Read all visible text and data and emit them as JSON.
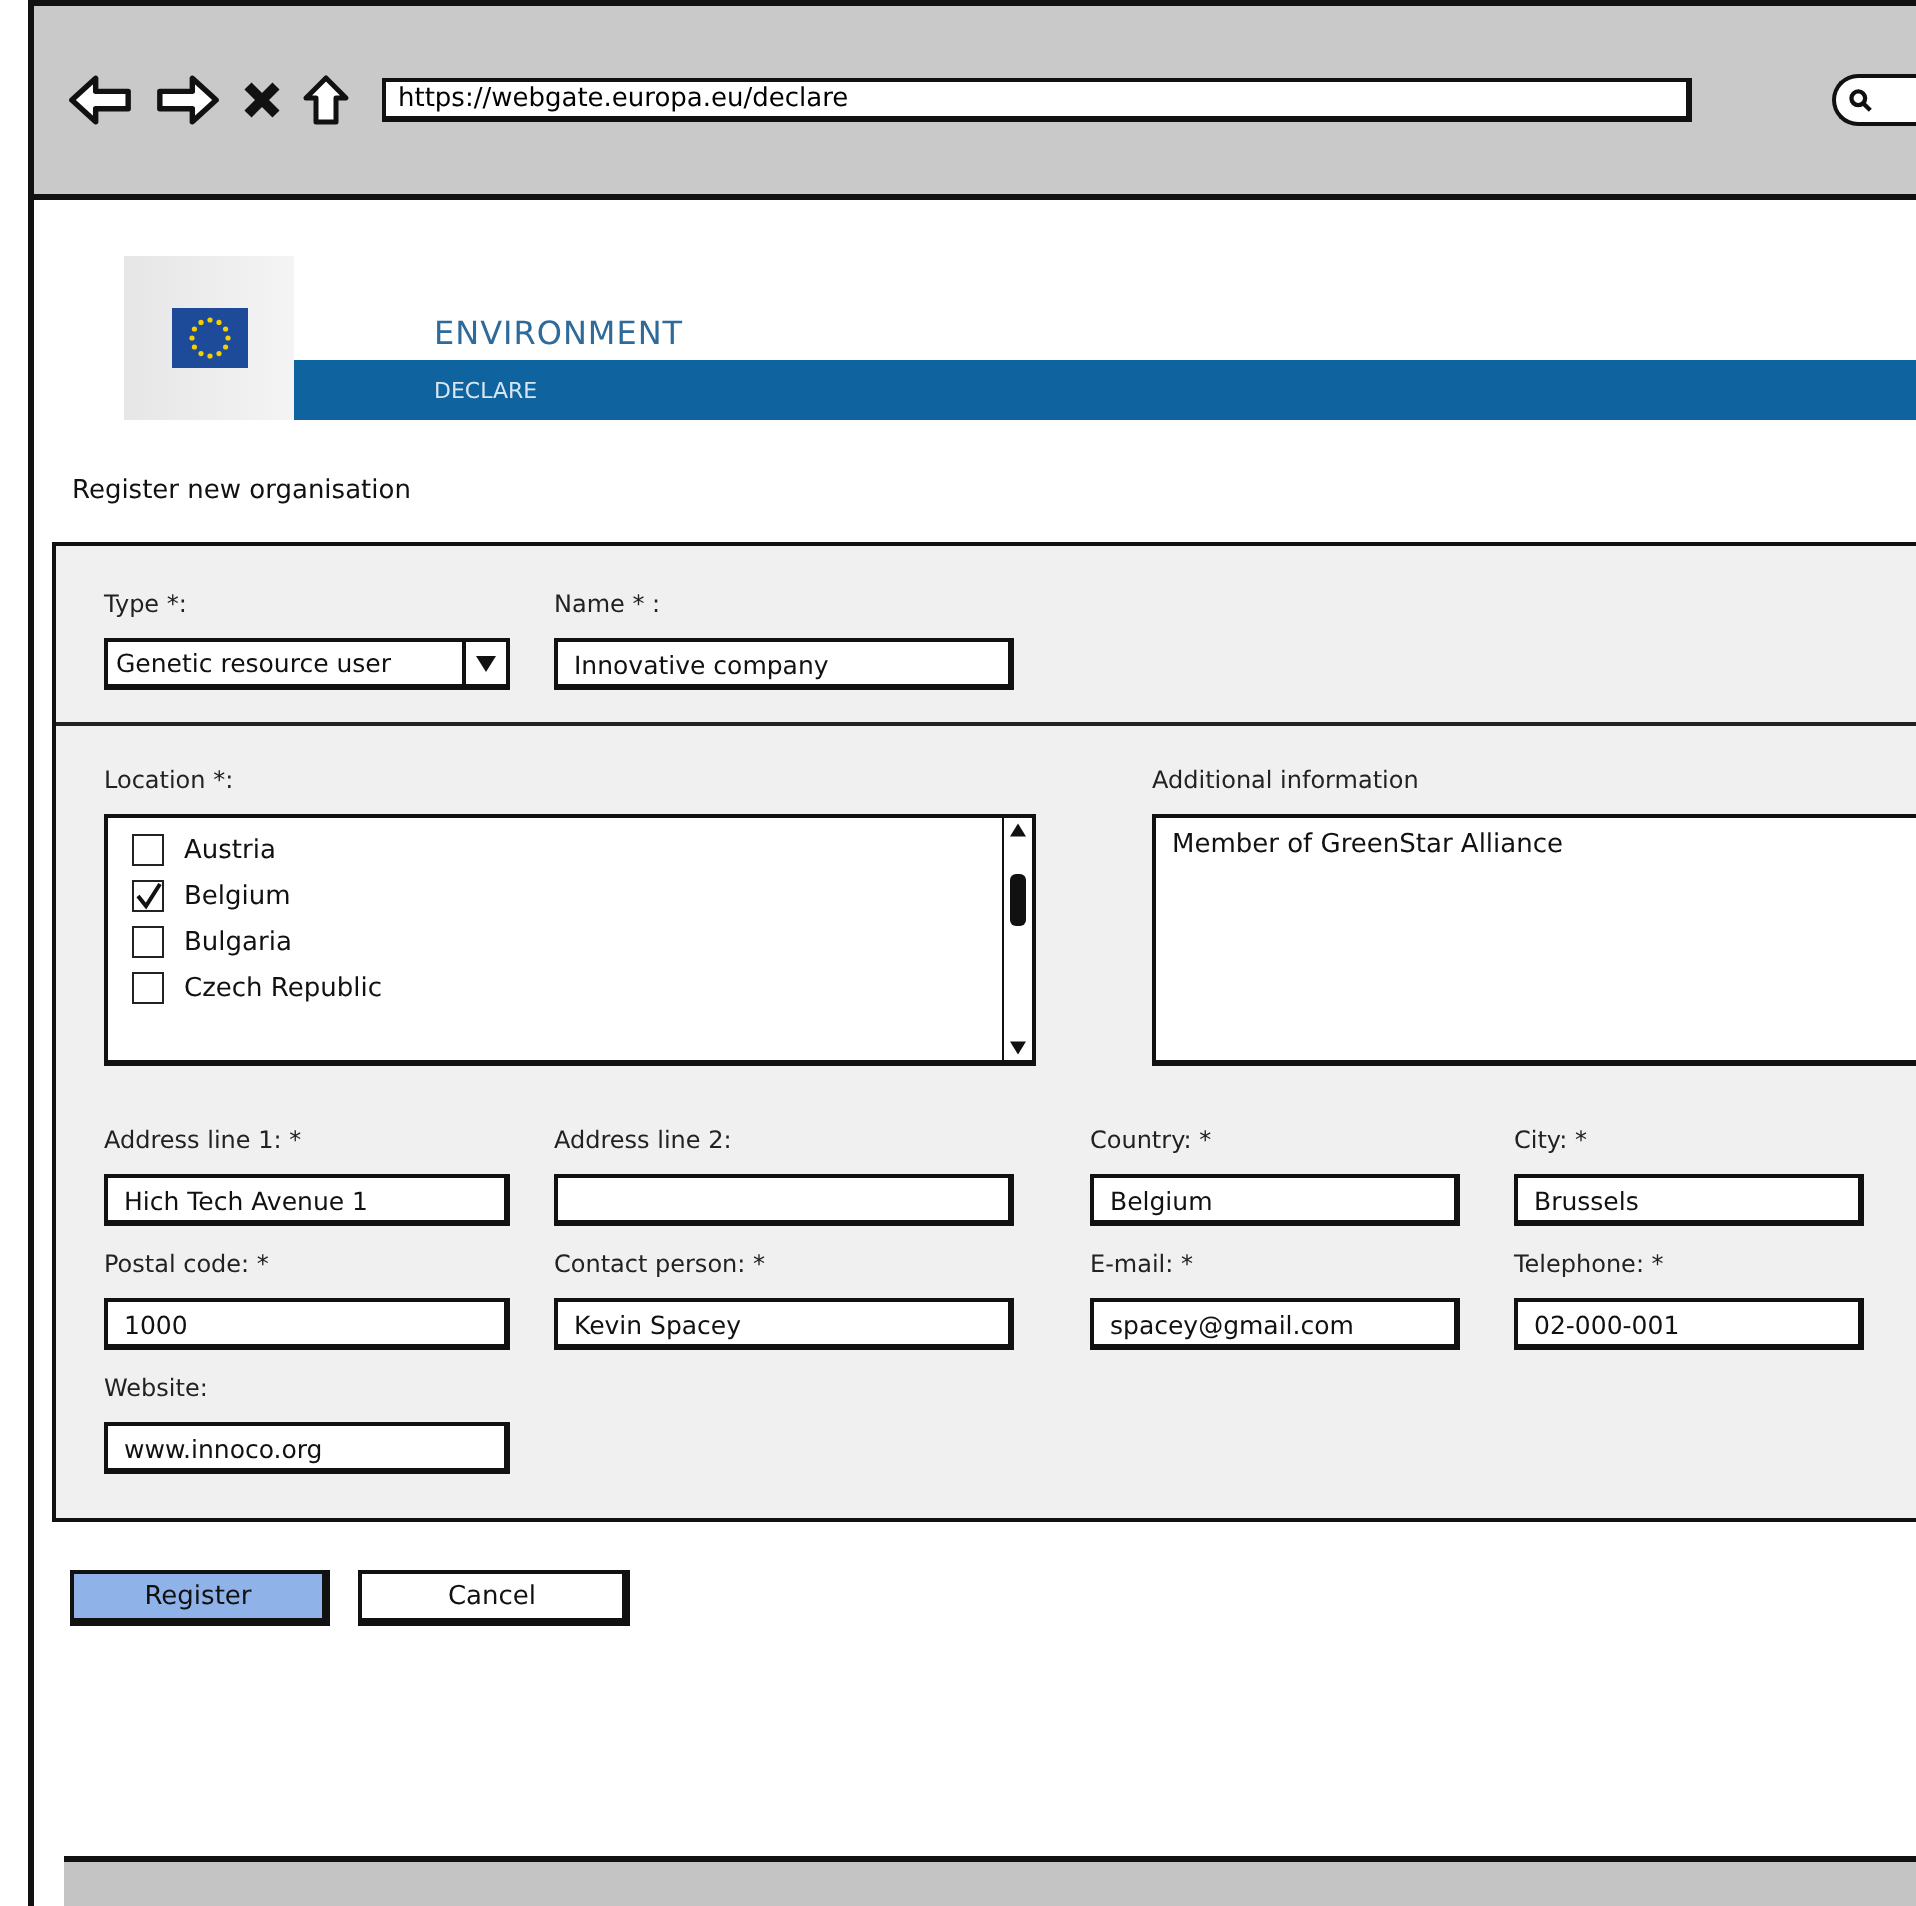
{
  "browser": {
    "url": "https://webgate.europa.eu/declare"
  },
  "banner": {
    "title": "ENVIRONMENT",
    "subtitle": "DECLARE"
  },
  "page_title": "Register new organisation",
  "type_field": {
    "label": "Type *:",
    "value": "Genetic resource user"
  },
  "name_field": {
    "label": "Name * :",
    "value": "Innovative company"
  },
  "location": {
    "label": "Location *:",
    "items": [
      {
        "label": "Austria",
        "checked": false
      },
      {
        "label": "Belgium",
        "checked": true
      },
      {
        "label": "Bulgaria",
        "checked": false
      },
      {
        "label": "Czech Republic",
        "checked": false
      }
    ]
  },
  "additional": {
    "label": "Additional information",
    "value": "Member of GreenStar Alliance"
  },
  "field_rows": [
    [
      {
        "label": "Address line 1: *",
        "value": "Hich Tech Avenue 1"
      },
      {
        "label": "Address line 2:"
      },
      {
        "label": "Country: *",
        "value": "Belgium"
      },
      {
        "label": "City: *",
        "value": "Brussels"
      }
    ],
    [
      {
        "label": "Postal code: *",
        "value": "1000"
      },
      {
        "label": "Contact person: *",
        "value": "Kevin Spacey"
      },
      {
        "label": "E-mail: *",
        "value": "spacey@gmail.com"
      },
      {
        "label": "Telephone: *",
        "value": "02-000-001"
      }
    ],
    [
      {
        "label": "Website:",
        "value": "www.innoco.org"
      }
    ]
  ],
  "buttons": [
    {
      "label": "Register",
      "kind": "primary"
    },
    {
      "label": "Cancel",
      "kind": "secondary"
    }
  ]
}
